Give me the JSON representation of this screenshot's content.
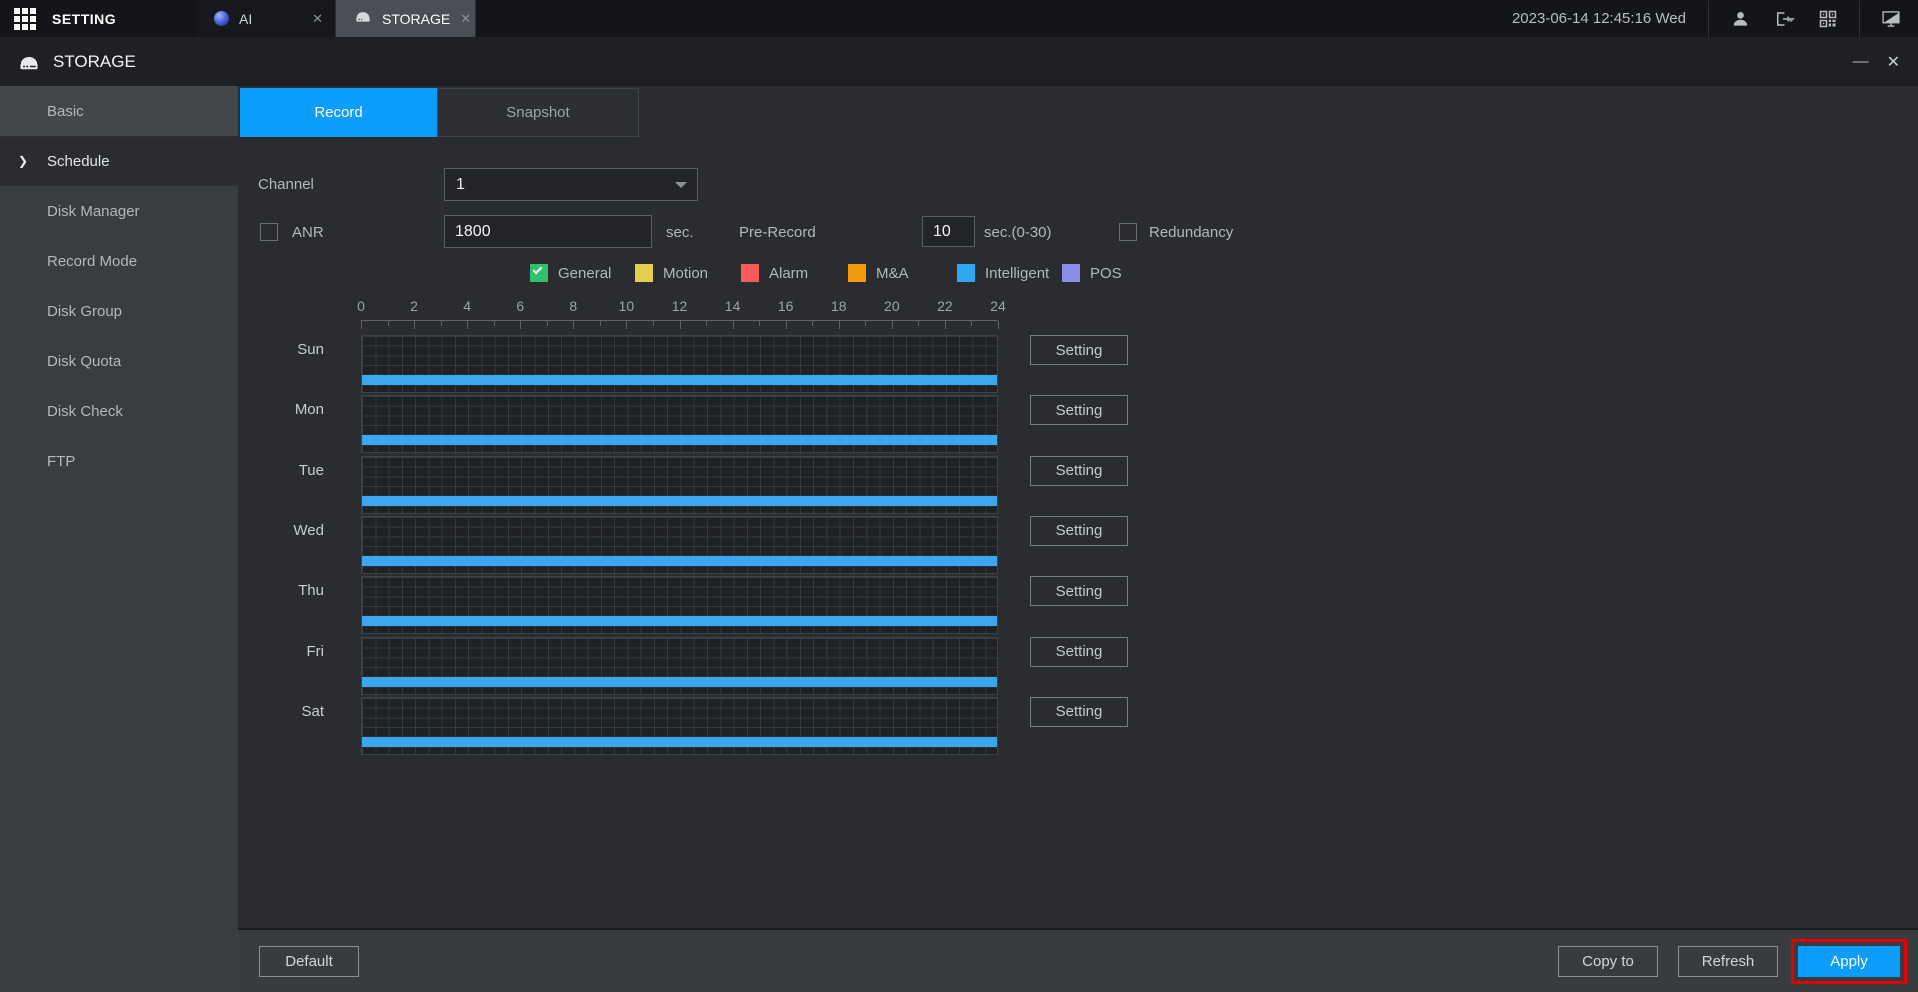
{
  "topbar": {
    "menu_label": "SETTING",
    "tabs": [
      {
        "label": "AI",
        "active": false,
        "icon": "ai-sphere-icon"
      },
      {
        "label": "STORAGE",
        "active": true,
        "icon": "disk-icon"
      }
    ],
    "datetime": "2023-06-14 12:45:16 Wed",
    "close_glyph": "✕"
  },
  "window": {
    "title": "STORAGE",
    "minimize_glyph": "—",
    "close_glyph": "✕"
  },
  "sidebar": {
    "items": [
      {
        "label": "Basic",
        "active": false
      },
      {
        "label": "Schedule",
        "active": true
      },
      {
        "label": "Disk Manager",
        "active": false
      },
      {
        "label": "Record Mode",
        "active": false
      },
      {
        "label": "Disk Group",
        "active": false
      },
      {
        "label": "Disk Quota",
        "active": false
      },
      {
        "label": "Disk Check",
        "active": false
      },
      {
        "label": "FTP",
        "active": false
      }
    ]
  },
  "main": {
    "tabs": [
      {
        "label": "Record",
        "active": true
      },
      {
        "label": "Snapshot",
        "active": false
      }
    ],
    "channel": {
      "label": "Channel",
      "value": "1"
    },
    "anr": {
      "label": "ANR",
      "checked": false,
      "value": "1800",
      "unit": "sec."
    },
    "pre_record": {
      "label": "Pre-Record",
      "value": "10",
      "unit": "sec.(0-30)"
    },
    "redundancy": {
      "label": "Redundancy",
      "checked": false
    },
    "legend": [
      {
        "label": "General",
        "color": "#2fc26e",
        "checked": true
      },
      {
        "label": "Motion",
        "color": "#e3ce4b",
        "checked": false
      },
      {
        "label": "Alarm",
        "color": "#f95a5a",
        "checked": false
      },
      {
        "label": "M&A",
        "color": "#f09a0c",
        "checked": false
      },
      {
        "label": "Intelligent",
        "color": "#2ea7f0",
        "checked": false
      },
      {
        "label": "POS",
        "color": "#8a8de8",
        "checked": false
      }
    ],
    "schedule": {
      "hour_labels": [
        "0",
        "2",
        "4",
        "6",
        "8",
        "10",
        "12",
        "14",
        "16",
        "18",
        "20",
        "22",
        "24"
      ],
      "days": [
        "Sun",
        "Mon",
        "Tue",
        "Wed",
        "Thu",
        "Fri",
        "Sat"
      ],
      "setting_label": "Setting",
      "bar_color": "#3ba7f0",
      "bar_type": "Intelligent",
      "bars": [
        {
          "day": "Sun",
          "start": 0,
          "end": 24
        },
        {
          "day": "Mon",
          "start": 0,
          "end": 24
        },
        {
          "day": "Tue",
          "start": 0,
          "end": 24
        },
        {
          "day": "Wed",
          "start": 0,
          "end": 24
        },
        {
          "day": "Thu",
          "start": 0,
          "end": 24
        },
        {
          "day": "Fri",
          "start": 0,
          "end": 24
        },
        {
          "day": "Sat",
          "start": 0,
          "end": 24
        }
      ]
    }
  },
  "footer": {
    "default_label": "Default",
    "copy_label": "Copy to",
    "refresh_label": "Refresh",
    "apply_label": "Apply",
    "apply_highlight_color": "#e60000"
  }
}
